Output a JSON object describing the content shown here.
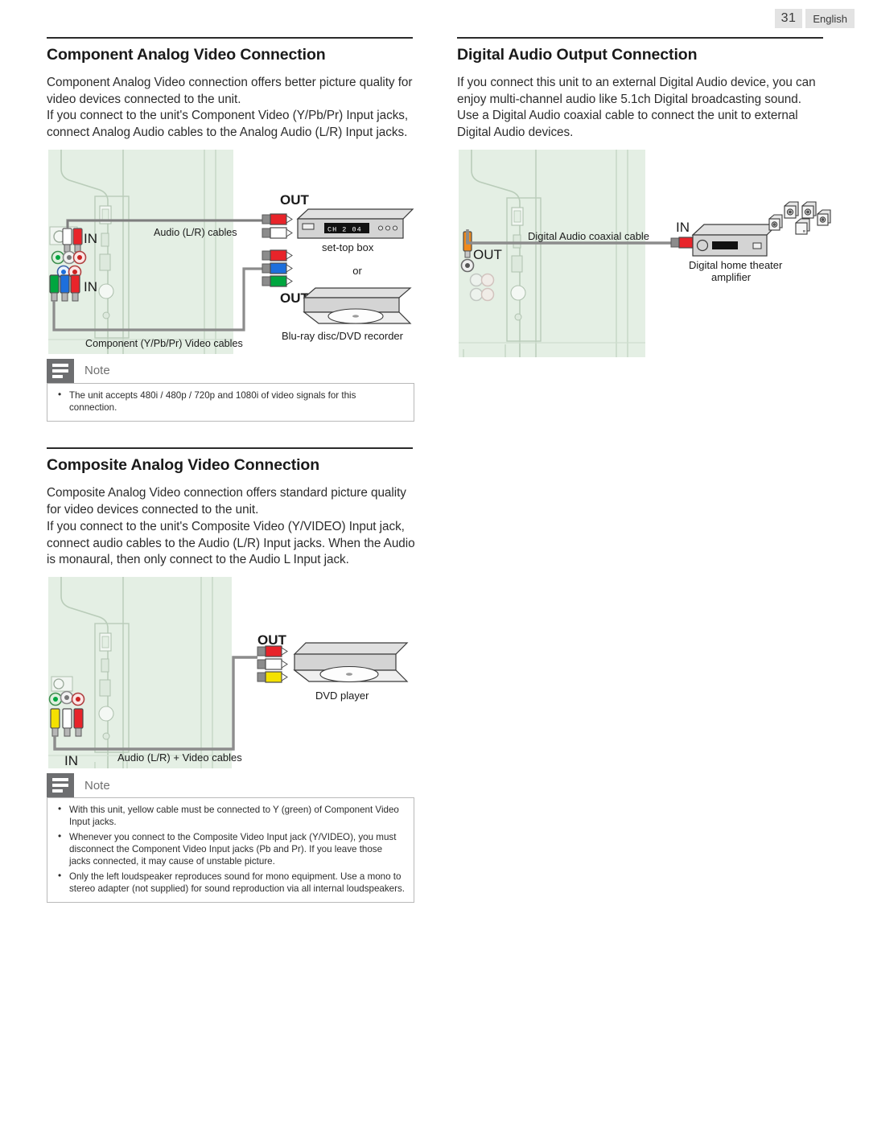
{
  "header": {
    "page_number": "31",
    "language": "English"
  },
  "left_column": {
    "section1": {
      "title": "Component Analog Video Connection",
      "paragraphs": [
        "Component Analog Video connection offers better picture quality for video devices connected to the unit.",
        "If you connect to the unit's Component Video (Y/Pb/Pr) Input jacks, connect Analog Audio cables to the Analog Audio (L/R) Input jacks."
      ],
      "figure": {
        "labels": {
          "out_top": "OUT",
          "out_bottom": "OUT",
          "in_audio": "IN",
          "in_component": "IN",
          "audio_cables": "Audio (L/R) cables",
          "component_cables": "Component (Y/Pb/Pr) Video cables",
          "set_top_box": "set-top box",
          "or": "or",
          "bluray": "Blu-ray disc/DVD recorder",
          "stb_display": "CH 2 04"
        }
      },
      "note": {
        "label": "Note",
        "items": [
          "The unit accepts 480i / 480p / 720p and 1080i of video signals for this connection."
        ]
      }
    },
    "section2": {
      "title": "Composite Analog Video Connection",
      "paragraphs": [
        "Composite Analog Video connection offers standard picture quality for video devices connected to the unit.",
        "If you connect to the unit's Composite Video (Y/VIDEO) Input jack, connect audio cables to the Audio (L/R) Input jacks. When the Audio is monaural, then only connect to the Audio L Input jack."
      ],
      "figure": {
        "labels": {
          "out": "OUT",
          "in": "IN",
          "cables": "Audio (L/R) + Video cables",
          "dvd_player": "DVD player"
        }
      },
      "note": {
        "label": "Note",
        "items": [
          "With this unit, yellow cable must be connected to Y (green) of Component Video Input jacks.",
          "Whenever you connect to the Composite Video Input jack (Y/VIDEO), you must disconnect the Component Video Input jacks (Pb and Pr). If you leave those jacks connected, it may cause of unstable picture.",
          "Only the left loudspeaker reproduces sound for mono equipment. Use a mono to stereo adapter (not supplied) for sound reproduction via all internal loudspeakers."
        ]
      }
    }
  },
  "right_column": {
    "section1": {
      "title": "Digital Audio Output Connection",
      "paragraphs": [
        "If you connect this unit to an external Digital Audio device, you can enjoy multi-channel audio like 5.1ch Digital broadcasting sound.",
        "Use a Digital Audio coaxial cable to connect the unit to external Digital Audio devices."
      ],
      "figure": {
        "labels": {
          "in": "IN",
          "out": "OUT",
          "coaxial_cable": "Digital Audio coaxial cable",
          "amplifier_line1": "Digital home theater",
          "amplifier_line2": "amplifier"
        }
      }
    }
  },
  "colors": {
    "tv_body": "#e4efe4",
    "device_body": "#d4d4d4",
    "plug_red": "#e8242a",
    "plug_white": "#ffffff",
    "plug_yellow": "#f4e100",
    "plug_green": "#00a63f",
    "plug_blue": "#1d6fdc",
    "plug_orange": "#f08a1b",
    "note_icon_bg": "#6d6e70",
    "rule": "#2b2b2b"
  }
}
